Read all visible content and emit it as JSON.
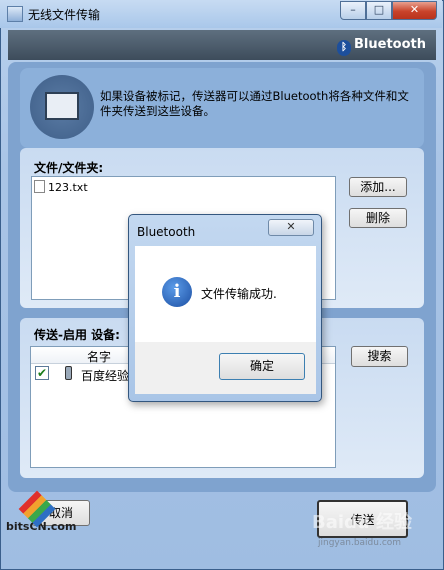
{
  "window": {
    "title": "无线文件传输",
    "controls": {
      "minimize": "–",
      "maximize": "□",
      "close": "✕"
    }
  },
  "banner": {
    "brand": "Bluetooth",
    "brand_mark": "ᛒ"
  },
  "intro": {
    "text": "如果设备被标记，传送器可以通过Bluetooth将各种文件和文件夹传送到这些设备。"
  },
  "files": {
    "label": "文件/文件夹:",
    "items": [
      "123.txt"
    ],
    "add_label": "添加...",
    "delete_label": "删除"
  },
  "send_to": {
    "label": "传送-启用 设备:",
    "column_name": "名字",
    "devices": [
      {
        "name": "百度经验",
        "checked": true
      }
    ],
    "search_label": "搜索"
  },
  "footer": {
    "cancel_label": "取消",
    "send_label": "传送"
  },
  "dialog": {
    "title": "Bluetooth",
    "close_glyph": "✕",
    "message": "文件传输成功.",
    "ok_label": "确定"
  },
  "watermarks": {
    "bitscn": "bitsCN.com",
    "baidu": "Baidu 经验",
    "baidu_url": "jingyan.baidu.com"
  }
}
